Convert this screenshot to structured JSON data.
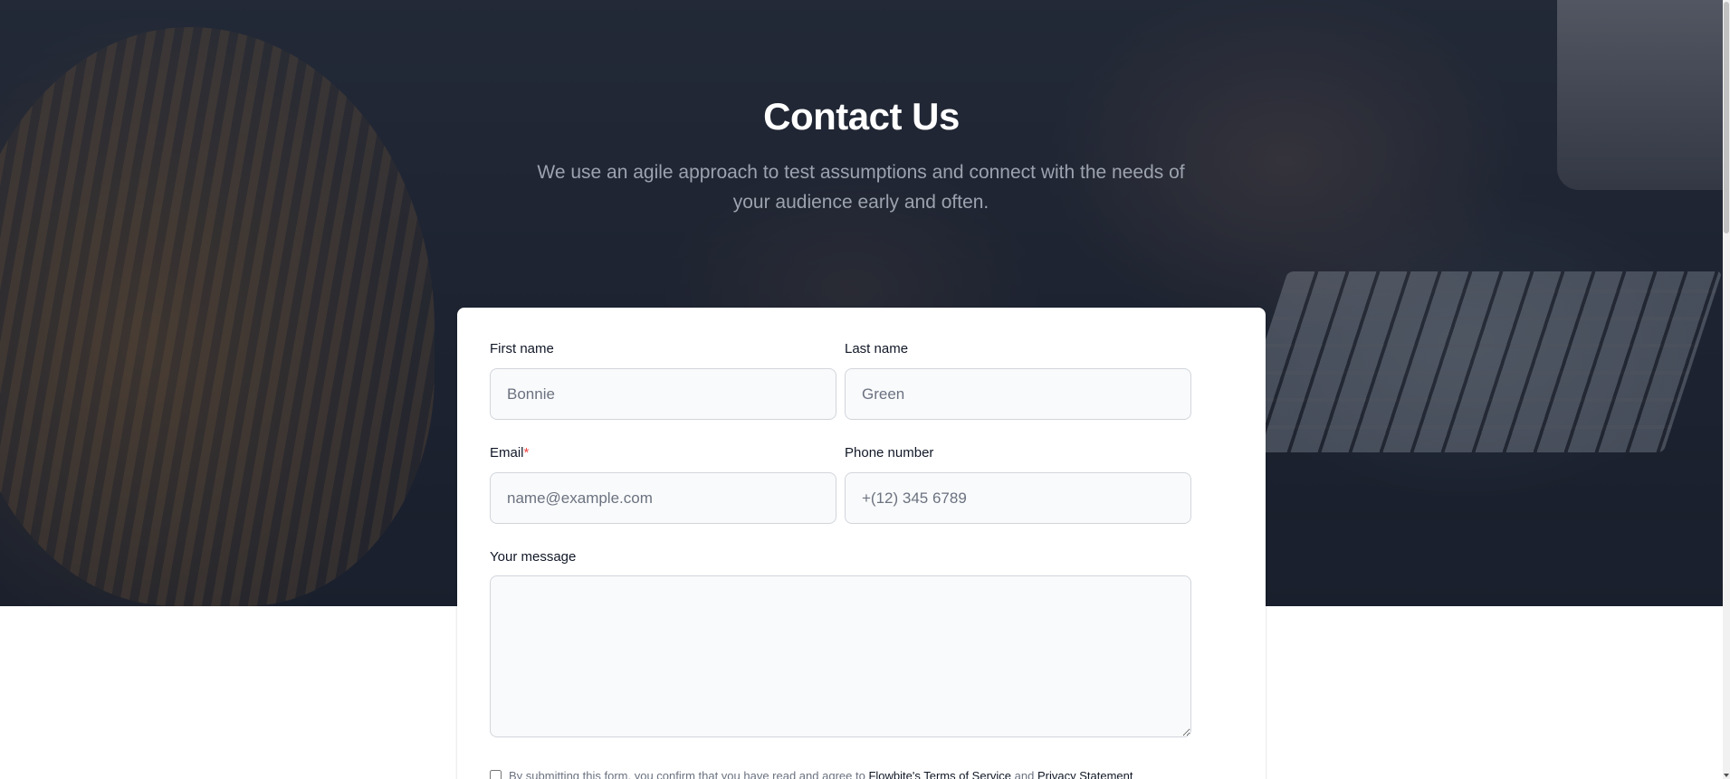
{
  "hero": {
    "title": "Contact Us",
    "subtitle": "We use an agile approach to test assumptions and connect with the needs of your audience early and often."
  },
  "form": {
    "first_name": {
      "label": "First name",
      "placeholder": "Bonnie"
    },
    "last_name": {
      "label": "Last name",
      "placeholder": "Green"
    },
    "email": {
      "label": "Email",
      "required_mark": "*",
      "placeholder": "name@example.com"
    },
    "phone": {
      "label": "Phone number",
      "placeholder": "+(12) 345 6789"
    },
    "message": {
      "label": "Your message",
      "placeholder": ""
    },
    "terms": {
      "prefix": "By submitting this form, you confirm that you have read and agree to",
      "terms_link": "Flowbite's Terms of Service",
      "joiner": "and",
      "privacy_link": "Privacy Statement",
      "checked": false
    }
  },
  "colors": {
    "hero_overlay": "#111827",
    "title": "#ffffff",
    "subtitle": "#9ca3af",
    "input_background": "#f9fafb",
    "input_border": "#d1d5db",
    "required": "#ef4444",
    "label_text": "#111827"
  }
}
